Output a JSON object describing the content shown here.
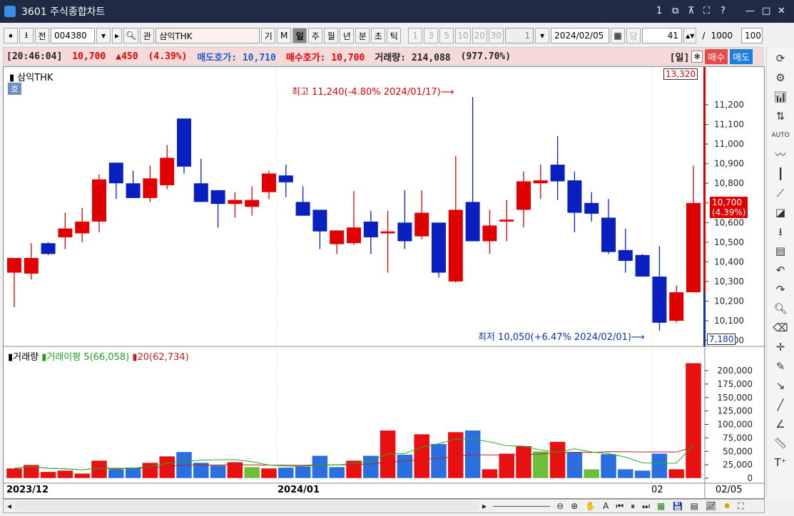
{
  "window": {
    "title": "3601 주식종합차트",
    "buttons": [
      "1",
      "⧉",
      "⊼",
      "⛶",
      "?",
      "—",
      "□",
      "✕"
    ]
  },
  "toolbar": {
    "code": "004380",
    "name": "삼익THK",
    "jeon": "전",
    "gwan": "관",
    "gi": "기",
    "m": "M",
    "periods": [
      "일",
      "주",
      "월",
      "년",
      "분",
      "초",
      "틱"
    ],
    "active_period": "일",
    "intervals": [
      "1",
      "3",
      "5",
      "10",
      "20",
      "30"
    ],
    "interval_value": "1",
    "date": "2024/02/05",
    "dang": "당",
    "count": "41",
    "count_sep": "/",
    "count_max": "1000",
    "zoom": "100"
  },
  "info": {
    "time": "[20:46:04]",
    "price": "10,700",
    "change": "▲450",
    "change_pct": "(4.39%)",
    "ask_label": "매도호가:",
    "ask": "10,710",
    "bid_label": "매수호가:",
    "bid": "10,700",
    "vol_label": "거래량:",
    "volume": "214,088",
    "vol_pct": "(977.70%)",
    "period_tag": "[일]",
    "buy": "매수",
    "sell": "매도"
  },
  "price_panel": {
    "title": "삼익THK",
    "badge": "호",
    "max_box": "13,320",
    "min_box": "7,180",
    "current": "10,700",
    "current_pct": "(4.39%)",
    "high_annot": "최고 11,240(-4.80% 2024/01/17)⟶",
    "low_annot": "최저 10,050(+6.47% 2024/02/01)⟶",
    "ticks": [
      "11,200",
      "11,100",
      "11,000",
      "10,900",
      "10,800",
      "10,700",
      "10,600",
      "10,500",
      "10,400",
      "10,300",
      "10,200",
      "10,100",
      "10,000"
    ]
  },
  "volume_panel": {
    "title": "거래량",
    "ma5_label": "거래이평 5(66,058)",
    "ma20_label": "20(62,734)",
    "ticks": [
      "200,000",
      "175,000",
      "150,000",
      "125,000",
      "100,000",
      "75,000",
      "50,000",
      "25,000",
      "0"
    ]
  },
  "xaxis": {
    "labels": [
      "2023/12",
      "2024/01",
      "02"
    ],
    "cursor_date": "02/05"
  },
  "colors": {
    "up": "#e00000",
    "down": "#0a1fc0",
    "vol_up": "#e81010",
    "vol_down": "#2a6fe0",
    "vol_flat": "#6cbf3a",
    "ma5": "#20b020",
    "ma20": "#c02020"
  },
  "chart_data": {
    "type": "candlestick",
    "ohlc": [
      [
        10345,
        10420,
        10170,
        10420
      ],
      [
        10340,
        10495,
        10310,
        10420
      ],
      [
        10495,
        10500,
        10435,
        10440
      ],
      [
        10525,
        10650,
        10465,
        10570
      ],
      [
        10545,
        10675,
        10500,
        10605
      ],
      [
        10605,
        10845,
        10550,
        10820
      ],
      [
        10905,
        10905,
        10720,
        10800
      ],
      [
        10800,
        10865,
        10725,
        10725
      ],
      [
        10725,
        10890,
        10705,
        10825
      ],
      [
        10790,
        10995,
        10770,
        10930
      ],
      [
        11130,
        11130,
        10850,
        10885
      ],
      [
        10800,
        10925,
        10705,
        10705
      ],
      [
        10765,
        10765,
        10575,
        10695
      ],
      [
        10695,
        10755,
        10625,
        10715
      ],
      [
        10680,
        10785,
        10635,
        10715
      ],
      [
        10755,
        10865,
        10720,
        10850
      ],
      [
        10840,
        10895,
        10730,
        10805
      ],
      [
        10705,
        10785,
        10635,
        10635
      ],
      [
        10665,
        10665,
        10465,
        10555
      ],
      [
        10490,
        10560,
        10440,
        10560
      ],
      [
        10495,
        10760,
        10485,
        10575
      ],
      [
        10605,
        10660,
        10440,
        10525
      ],
      [
        10545,
        10660,
        10345,
        10555
      ],
      [
        10600,
        10765,
        10465,
        10505
      ],
      [
        10530,
        10765,
        10515,
        10650
      ],
      [
        10600,
        10600,
        10320,
        10345
      ],
      [
        10300,
        10940,
        10295,
        10665
      ],
      [
        10705,
        11240,
        10505,
        10505
      ],
      [
        10505,
        10665,
        10440,
        10585
      ],
      [
        10605,
        10715,
        10505,
        10615
      ],
      [
        10665,
        10860,
        10575,
        10810
      ],
      [
        10800,
        10895,
        10720,
        10815
      ],
      [
        10895,
        11040,
        10715,
        10810
      ],
      [
        10815,
        10860,
        10550,
        10650
      ],
      [
        10700,
        10755,
        10605,
        10645
      ],
      [
        10625,
        10720,
        10440,
        10450
      ],
      [
        10460,
        10570,
        10345,
        10405
      ],
      [
        10435,
        10440,
        10325,
        10325
      ],
      [
        10325,
        10480,
        10050,
        10090
      ],
      [
        10100,
        10280,
        10090,
        10245
      ],
      [
        10245,
        10890,
        10245,
        10700
      ]
    ],
    "volume": [
      18500,
      25000,
      12000,
      14500,
      9000,
      33000,
      17000,
      20000,
      29000,
      41000,
      49000,
      29000,
      24000,
      30000,
      21000,
      18500,
      20000,
      22000,
      42000,
      21000,
      33000,
      42000,
      89000,
      44000,
      82000,
      64000,
      86000,
      89000,
      17000,
      46000,
      60000,
      50000,
      68000,
      49000,
      17000,
      45000,
      17000,
      14500,
      46000,
      17000,
      214088
    ],
    "volume_color": [
      "u",
      "u",
      "u",
      "u",
      "u",
      "u",
      "d",
      "d",
      "u",
      "u",
      "d",
      "d",
      "d",
      "u",
      "f",
      "u",
      "d",
      "d",
      "d",
      "d",
      "u",
      "d",
      "u",
      "d",
      "u",
      "d",
      "u",
      "d",
      "u",
      "u",
      "u",
      "f",
      "u",
      "d",
      "f",
      "d",
      "d",
      "d",
      "d",
      "u",
      "u"
    ],
    "price_range": [
      10000,
      11300
    ],
    "volume_range": [
      0,
      225000
    ]
  }
}
